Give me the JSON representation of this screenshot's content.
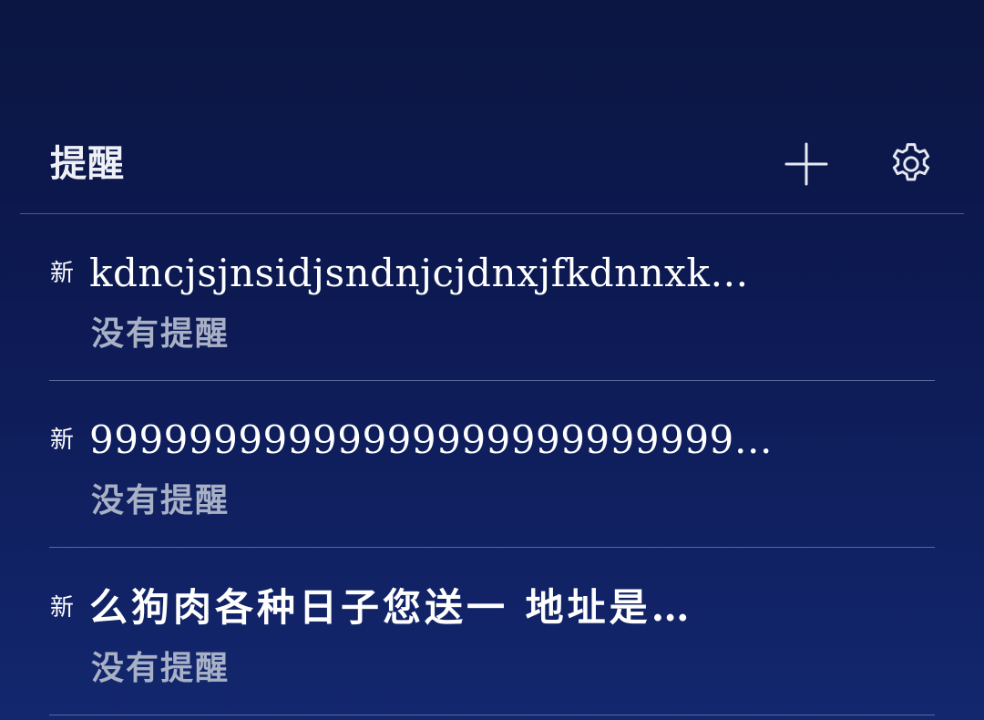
{
  "header": {
    "title": "提醒",
    "add_icon": "plus-icon",
    "settings_icon": "gear-icon"
  },
  "reminders": [
    {
      "badge": "新",
      "title": "kdncjsjnsidjsndnjcjdnxjfkdnnxk…",
      "subtitle": "没有提醒"
    },
    {
      "badge": "新",
      "title": "99999999999999999999999999…",
      "subtitle": "没有提醒"
    },
    {
      "badge": "新",
      "title": "么狗肉各种日子您送一 地址是…",
      "subtitle": "没有提醒"
    }
  ],
  "colors": {
    "background_top": "#0b1642",
    "background_bottom": "#13276e",
    "title_text": "#eef0f6",
    "subtitle_text": "#a8b0c6",
    "divider": "#5a6898"
  }
}
